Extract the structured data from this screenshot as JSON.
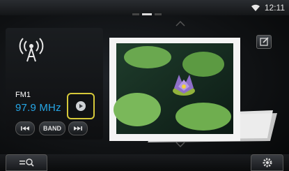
{
  "status": {
    "time": "12:11",
    "wifi_icon": "wifi-icon"
  },
  "radio": {
    "band": "FM1",
    "frequency": "97.9 MHz",
    "source_icon": "antenna-icon"
  },
  "controls": {
    "band_label": "BAND",
    "seek_down_icon": "seek-down-icon",
    "seek_up_icon": "seek-up-icon",
    "menu_icon": "circle-menu-icon"
  },
  "artwork": {
    "subject": "album-art-photo"
  },
  "top_right_button_icon": "edit-icon",
  "bottom_bar": {
    "left_icon": "search-list-icon",
    "right_icon": "gear-icon"
  },
  "colors": {
    "accent": "#26a7e6",
    "highlight": "#d6c93a"
  }
}
